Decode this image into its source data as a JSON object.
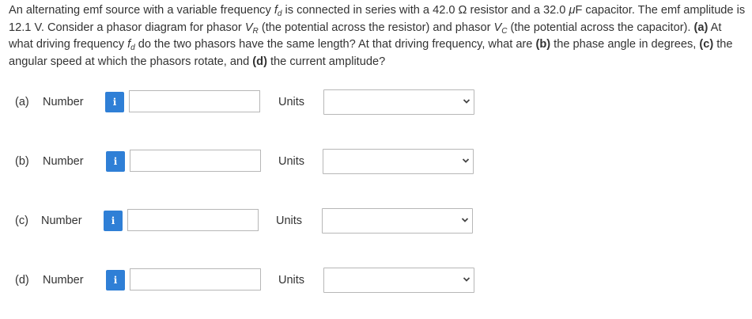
{
  "question": {
    "t1": "An alternating emf source with a variable frequency ",
    "fd_main": "f",
    "fd_sub": "d",
    "t2": " is connected in series with a 42.0 Ω resistor and a 32.0 ",
    "mu": "μ",
    "t3": "F capacitor. The emf amplitude is 12.1 V. Consider a phasor diagram for phasor ",
    "vr_main": "V",
    "vr_sub": "R",
    "t4": " (the potential across the resistor) and phasor ",
    "vc_main": "V",
    "vc_sub": "C",
    "t5": " (the potential across the capacitor). ",
    "a_label": "(a)",
    "t6": " At what driving frequency ",
    "fd2_main": "f",
    "fd2_sub": "d",
    "t7": " do the two phasors have the same length? At that driving frequency, what are ",
    "b_label": "(b)",
    "t8": " the phase angle in degrees, ",
    "c_label": "(c)",
    "t9": " the angular speed at which the phasors rotate, and ",
    "d_label": "(d)",
    "t10": " the current amplitude?"
  },
  "rows": [
    {
      "part": "(a)",
      "number_label": "Number",
      "info": "i",
      "value": "",
      "units_label": "Units",
      "units_value": ""
    },
    {
      "part": "(b)",
      "number_label": "Number",
      "info": "i",
      "value": "",
      "units_label": "Units",
      "units_value": ""
    },
    {
      "part": "(c)",
      "number_label": "Number",
      "info": "i",
      "value": "",
      "units_label": "Units",
      "units_value": ""
    },
    {
      "part": "(d)",
      "number_label": "Number",
      "info": "i",
      "value": "",
      "units_label": "Units",
      "units_value": ""
    }
  ],
  "colors": {
    "info_button": "#2f7fd6",
    "text": "#333333",
    "border": "#b7b7b7"
  },
  "icons": {
    "info": "info-icon",
    "dropdown": "chevron-down-icon"
  }
}
